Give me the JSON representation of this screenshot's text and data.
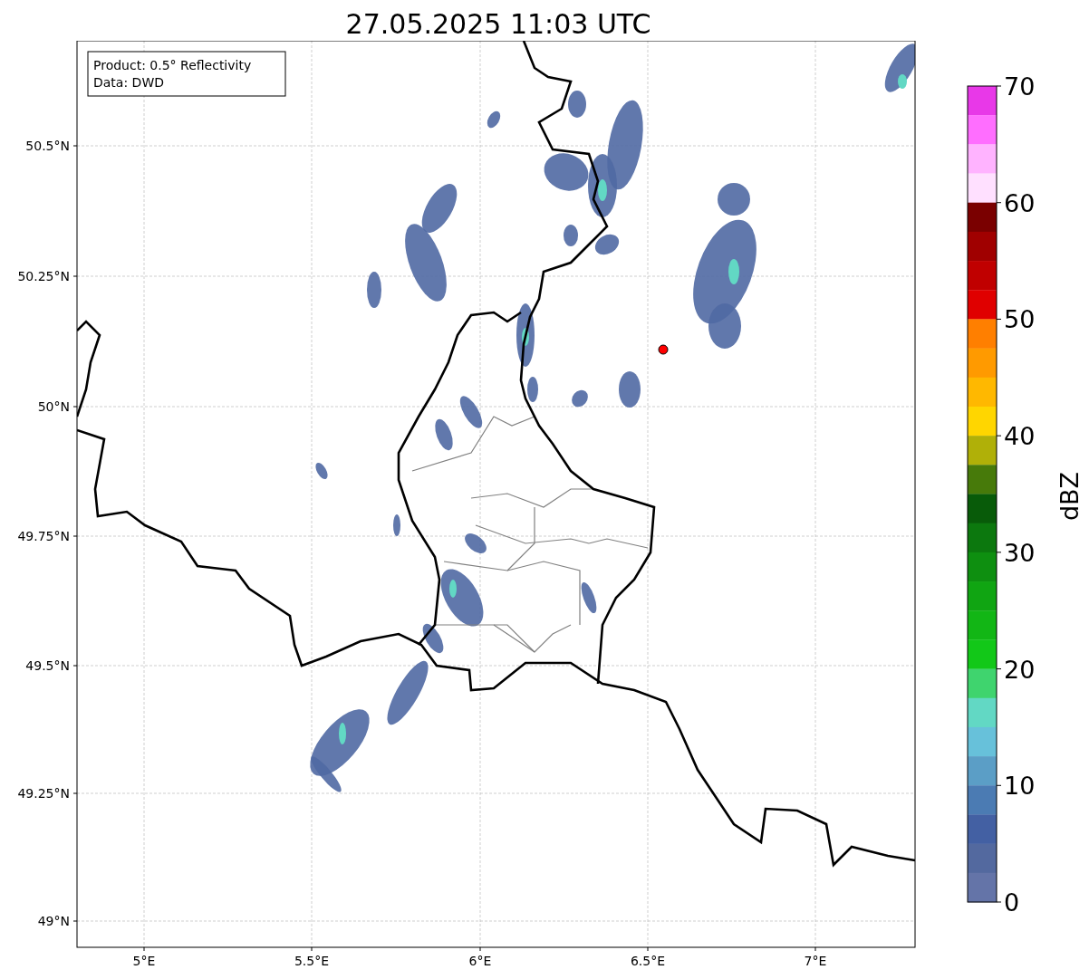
{
  "title": "27.05.2025 11:03 UTC",
  "legend": [
    "Product: 0.5° Reflectivity",
    "Data: DWD"
  ],
  "x_ticks": [
    "5°E",
    "5.5°E",
    "6°E",
    "6.5°E",
    "7°E"
  ],
  "y_ticks": [
    "50.5°N",
    "50.25°N",
    "50°N",
    "49.75°N",
    "49.5°N",
    "49.25°N",
    "49°N"
  ],
  "colorbar": {
    "label": "dBZ",
    "ticks": [
      "70",
      "60",
      "50",
      "40",
      "30",
      "20",
      "10",
      "0"
    ],
    "bins": [
      {
        "color": "#e838e8"
      },
      {
        "color": "#ff6eff"
      },
      {
        "color": "#ffb3ff"
      },
      {
        "color": "#ffe0ff"
      },
      {
        "color": "#7a0000"
      },
      {
        "color": "#a00000"
      },
      {
        "color": "#c00000"
      },
      {
        "color": "#e00000"
      },
      {
        "color": "#ff7f00"
      },
      {
        "color": "#ff9a00"
      },
      {
        "color": "#ffb800"
      },
      {
        "color": "#ffd600"
      },
      {
        "color": "#b0b008"
      },
      {
        "color": "#477a0a"
      },
      {
        "color": "#085b09"
      },
      {
        "color": "#0c780e"
      },
      {
        "color": "#0e8f10"
      },
      {
        "color": "#10a512"
      },
      {
        "color": "#12b615"
      },
      {
        "color": "#12c818"
      },
      {
        "color": "#3fd46e"
      },
      {
        "color": "#62d8c4"
      },
      {
        "color": "#67c1da"
      },
      {
        "color": "#5b9ec6"
      },
      {
        "color": "#4b7bb3"
      },
      {
        "color": "#4360a3"
      },
      {
        "color": "#53699f"
      },
      {
        "color": "#6474a8"
      }
    ]
  }
}
